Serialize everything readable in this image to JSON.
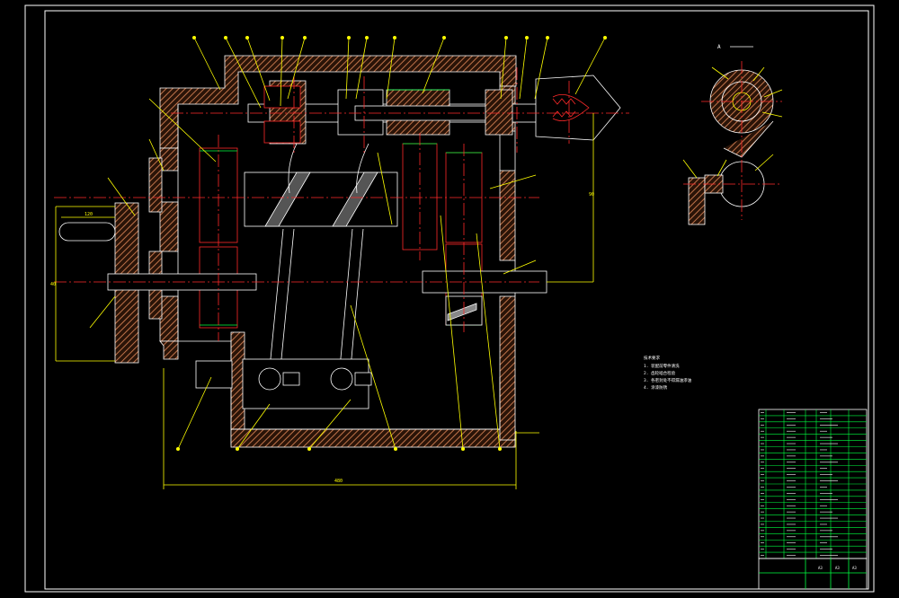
{
  "colors": {
    "background": "#000000",
    "frame": "#ffffff",
    "leader": "#ffff00",
    "centerline": "#ff2a2a",
    "hatch": "#c0734a",
    "gear": "#ff2a2a",
    "pitch": "#00ff40",
    "table_text": "#ffffff",
    "table_lines": "#00ff40"
  },
  "dimensions": {
    "bottom_overall": "480",
    "left_height": "40",
    "handwheel_width": "120",
    "right_vertical": "90"
  },
  "tech_notes": {
    "heading": "技术要求",
    "lines": [
      "1. 装配前零件清洗",
      "2. 齿轮啮合检验",
      "3. 各密封处不得漏油渗油",
      "4. 涂漆防锈"
    ]
  },
  "detail_view": {
    "label": "A"
  },
  "parts_table": {
    "rows": 24
  },
  "title_block": {
    "marks": [
      "A3",
      "A3",
      "A3"
    ]
  }
}
